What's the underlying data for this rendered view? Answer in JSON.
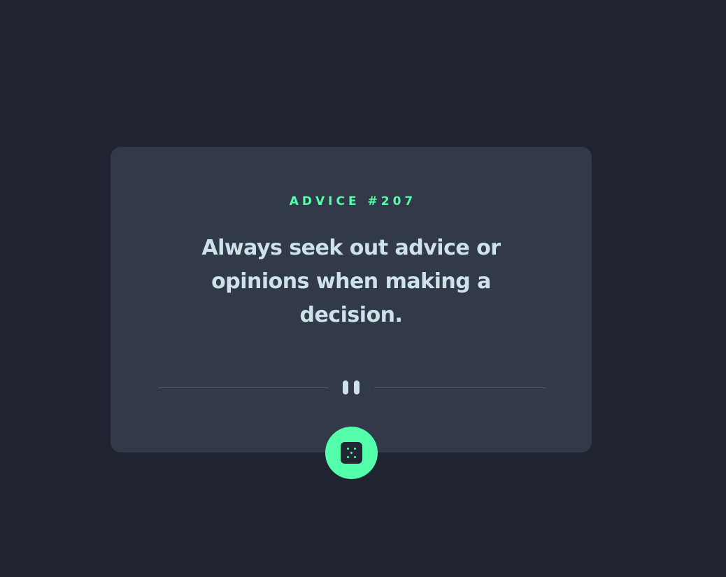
{
  "advice": {
    "label": "ADVICE #207",
    "quote": "Always seek out advice or opinions when making a decision."
  },
  "divider": {
    "icon": "pause-quote-icon"
  },
  "action": {
    "icon": "dice-icon",
    "accessible_label": ""
  },
  "colors": {
    "page_background": "#1f2430",
    "card_background": "#323a49",
    "accent": "#53ffab",
    "quote_text": "#cee3e9",
    "divider_line": "#4f5d74"
  }
}
